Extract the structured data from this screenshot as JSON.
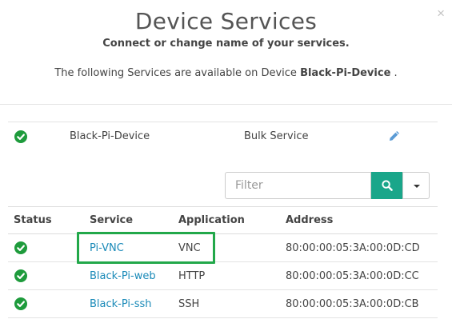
{
  "dialog": {
    "title": "Device Services",
    "subtitle": "Connect or change name of your services.",
    "available_prefix": "The following Services are available on Device",
    "device_name": "Black-Pi-Device",
    "available_suffix": " .",
    "close_glyph": "×"
  },
  "device_row": {
    "name": "Black-Pi-Device",
    "service_type": "Bulk Service"
  },
  "filter": {
    "placeholder": "Filter"
  },
  "table": {
    "headers": [
      "Status",
      "Service",
      "Application",
      "Address"
    ],
    "rows": [
      {
        "service": "Pi-VNC",
        "application": "VNC",
        "address": "80:00:00:05:3A:00:0D:CD"
      },
      {
        "service": "Black-Pi-web",
        "application": "HTTP",
        "address": "80:00:00:05:3A:00:0D:CC"
      },
      {
        "service": "Black-Pi-ssh",
        "application": "SSH",
        "address": "80:00:00:05:3A:00:0D:CB"
      }
    ]
  },
  "colors": {
    "status_ok": "#1e9b3c",
    "accent": "#1aa68a",
    "link": "#1a8ab8",
    "highlight": "#22a84a"
  },
  "icons": {
    "close": "close-icon",
    "status": "check-circle-icon",
    "edit": "pencil-icon",
    "search": "search-icon",
    "dropdown": "caret-down-icon"
  }
}
